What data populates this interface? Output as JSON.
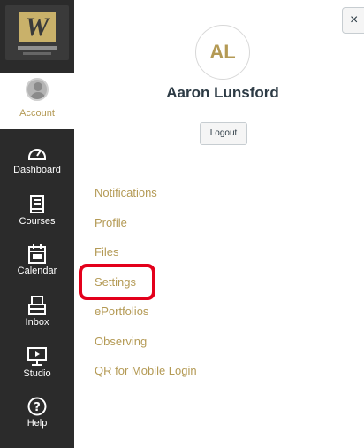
{
  "global_nav": {
    "logo_letter": "W",
    "account_label": "Account",
    "items": [
      {
        "label": "Dashboard",
        "icon": "dashboard-icon"
      },
      {
        "label": "Courses",
        "icon": "courses-icon"
      },
      {
        "label": "Calendar",
        "icon": "calendar-icon"
      },
      {
        "label": "Inbox",
        "icon": "inbox-icon"
      },
      {
        "label": "Studio",
        "icon": "studio-icon"
      },
      {
        "label": "Help",
        "icon": "help-icon"
      }
    ]
  },
  "tray": {
    "close_symbol": "×",
    "initials": "AL",
    "user_name": "Aaron Lunsford",
    "logout_label": "Logout",
    "links": [
      "Notifications",
      "Profile",
      "Files",
      "Settings",
      "ePortfolios",
      "Observing",
      "QR for Mobile Login"
    ],
    "highlighted_link": "Settings"
  },
  "colors": {
    "nav_bg": "#2b2b2b",
    "accent": "#b49a55",
    "highlight": "#e3001b",
    "text_dark": "#2d3b45"
  }
}
